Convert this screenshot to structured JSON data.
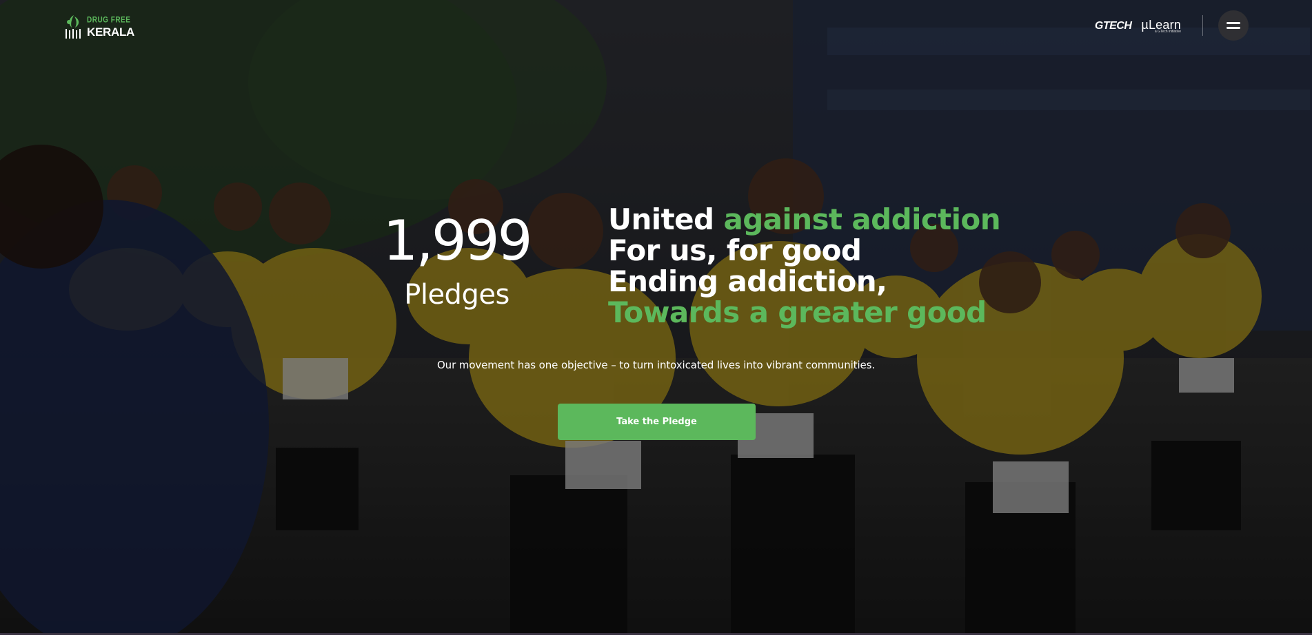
{
  "header": {
    "logo_top": "DRUG FREE",
    "logo_bottom": "KERALA",
    "partner_gtech": "GTECH",
    "partner_mulearn": "µLearn",
    "partner_mulearn_sub": "a GTech initiative",
    "menu_icon": "hamburger-icon"
  },
  "stats": {
    "count": "1,999",
    "label": "Pledges"
  },
  "headline": {
    "line1_white": "United ",
    "line1_green": "against addiction",
    "line2": "For us, for good",
    "line3": "Ending addiction,",
    "line4": "Towards a greater good"
  },
  "subtext": "Our movement has one objective – to turn intoxicated lives into vibrant communities.",
  "cta_label": "Take the Pledge",
  "colors": {
    "accent": "#5cb85c",
    "text": "#ffffff",
    "menu_bg": "#2f2f33"
  }
}
